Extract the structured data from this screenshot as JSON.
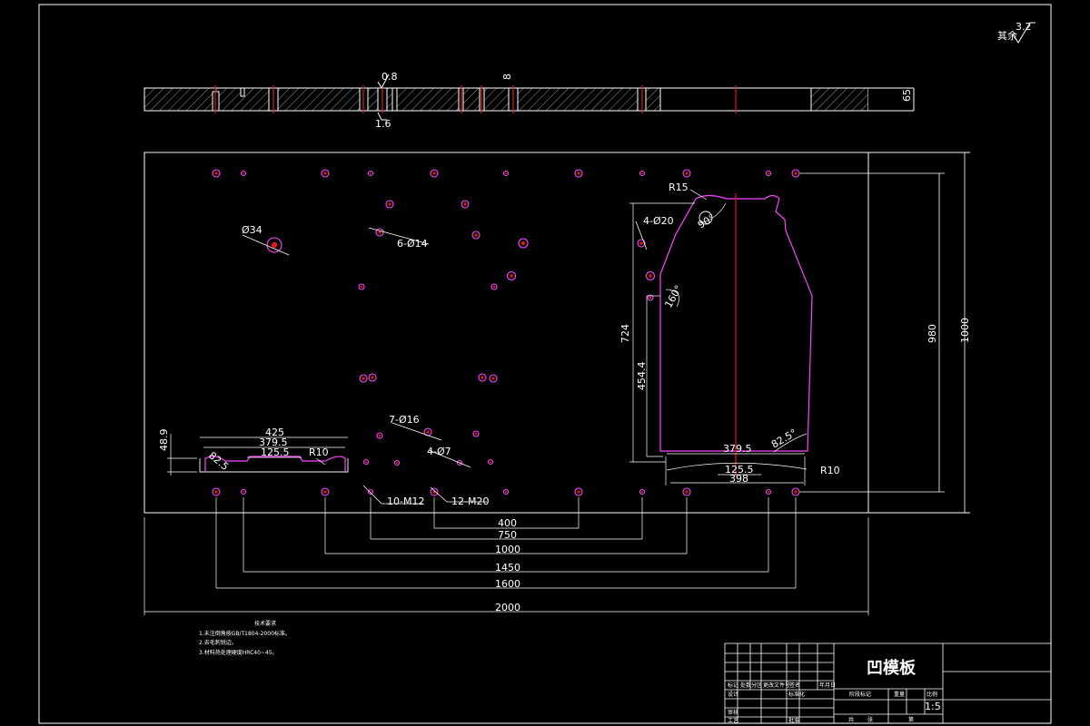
{
  "drawing": {
    "title": "凹模板",
    "scale": "1:5",
    "surface_mark": {
      "prefix": "其余",
      "value": "3.2"
    },
    "thickness_label": "65",
    "section_marks": {
      "roughness_top": "0.8",
      "roughness_bottom": "1.6",
      "mark_8": "8"
    },
    "overall_width": "2000",
    "plate_height_outer": "1000",
    "plate_height_inner": "980"
  },
  "dims_bottom": [
    "400",
    "750",
    "1000",
    "1450",
    "1600",
    "2000"
  ],
  "left_profile": {
    "width_top": "425",
    "width_mid": "379.5",
    "width_slot": "125.5",
    "height": "48.9",
    "radius": "R10",
    "angle": "82.5"
  },
  "right_profile": {
    "r_top": "R15",
    "angle_top": "90°",
    "angle_side": "160°",
    "height_total": "724",
    "height_lower": "454.4",
    "width_mid": "379.5",
    "width_slot": "125.5",
    "width_base": "398",
    "angle_right": "82.5°",
    "radius": "R10"
  },
  "hole_callouts": {
    "d34": "Ø34",
    "d14": "6-Ø14",
    "d20": "4-Ø20",
    "d16": "7-Ø16",
    "d7": "4-Ø7",
    "m12": "10-M12",
    "m20": "12-M20"
  },
  "notes": {
    "heading": "技术要求",
    "items": [
      "1.未注倒角按GB/T1804-2000标准。",
      "2.去毛刺锐边。",
      "3.材料热处理硬度HRC40~45。"
    ]
  },
  "title_block": {
    "labels": [
      "标记",
      "处数",
      "分区",
      "更改文件号",
      "签名",
      "年月日",
      "设计",
      "标准化",
      "审核",
      "工艺",
      "批准",
      "阶段标记",
      "重量",
      "比例",
      "共",
      "张",
      "第"
    ]
  }
}
